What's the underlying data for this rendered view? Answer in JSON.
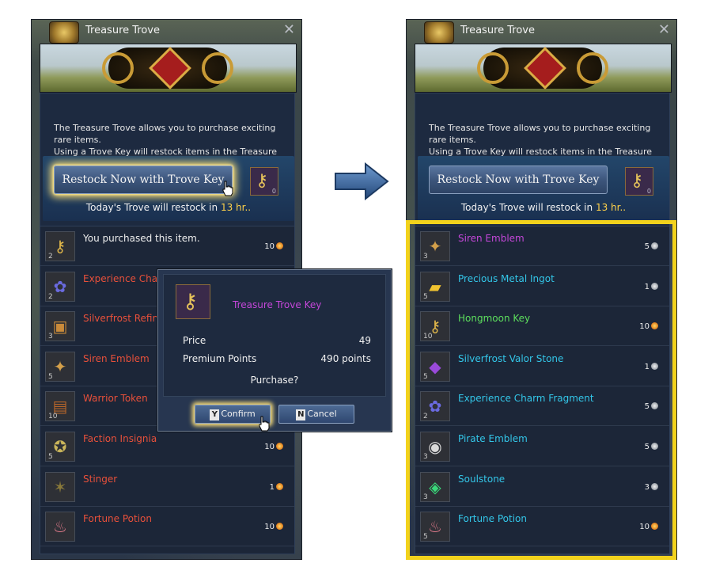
{
  "window_title": "Treasure Trove",
  "close_glyph": "✕",
  "description": {
    "line1": "The Treasure Trove allows you to purchase exciting rare items.",
    "line2": "Using a Trove Key will restock items in the Treasure Trove."
  },
  "restock": {
    "button_label": "Restock Now with Trove Key",
    "key_count": "0",
    "prefix": "Today's Trove will restock in",
    "hours": "13 hr..",
    "left_button_highlighted": true
  },
  "left_items": [
    {
      "name": "You purchased this item.",
      "qty": "2",
      "cost": "10",
      "coin": "gold",
      "color": "white",
      "icon": "key-icon"
    },
    {
      "name": "Experience Charm",
      "qty": "2",
      "cost": "",
      "coin": "",
      "color": "red",
      "icon": "charm-icon"
    },
    {
      "name": "Silverfrost Refinin",
      "qty": "3",
      "cost": "",
      "coin": "",
      "color": "red",
      "icon": "chest-icon"
    },
    {
      "name": "Siren Emblem",
      "qty": "5",
      "cost": "",
      "coin": "",
      "color": "red",
      "icon": "emblem-icon"
    },
    {
      "name": "Warrior Token",
      "qty": "10",
      "cost": "",
      "coin": "",
      "color": "red",
      "icon": "token-icon"
    },
    {
      "name": "Faction Insignia",
      "qty": "5",
      "cost": "10",
      "coin": "gold",
      "color": "red",
      "icon": "insignia-icon"
    },
    {
      "name": "Stinger",
      "qty": "",
      "cost": "1",
      "coin": "gold",
      "color": "red",
      "icon": "stinger-icon"
    },
    {
      "name": "Fortune Potion",
      "qty": "",
      "cost": "10",
      "coin": "gold",
      "color": "red",
      "icon": "potion-icon"
    }
  ],
  "right_items": [
    {
      "name": "Siren Emblem",
      "qty": "3",
      "cost": "5",
      "coin": "silver",
      "color": "purple",
      "icon": "emblem-icon"
    },
    {
      "name": "Precious Metal Ingot",
      "qty": "5",
      "cost": "1",
      "coin": "silver",
      "color": "cyan",
      "icon": "ingot-icon"
    },
    {
      "name": "Hongmoon Key",
      "qty": "10",
      "cost": "10",
      "coin": "gold",
      "color": "green",
      "icon": "key-icon"
    },
    {
      "name": "Silverfrost Valor Stone",
      "qty": "5",
      "cost": "1",
      "coin": "silver",
      "color": "cyan",
      "icon": "stone-icon"
    },
    {
      "name": "Experience Charm Fragment",
      "qty": "2",
      "cost": "5",
      "coin": "silver",
      "color": "cyan",
      "icon": "charm-icon"
    },
    {
      "name": "Pirate Emblem",
      "qty": "3",
      "cost": "5",
      "coin": "silver",
      "color": "cyan",
      "icon": "pirate-emblem-icon"
    },
    {
      "name": "Soulstone",
      "qty": "3",
      "cost": "3",
      "coin": "silver",
      "color": "cyan",
      "icon": "soulstone-icon"
    },
    {
      "name": "Fortune Potion",
      "qty": "5",
      "cost": "10",
      "coin": "gold",
      "color": "cyan",
      "icon": "potion-icon"
    }
  ],
  "dialog": {
    "item_name": "Treasure Trove Key",
    "price_label": "Price",
    "price_value": "49",
    "points_label": "Premium Points",
    "points_value": "490 points",
    "question": "Purchase?",
    "confirm_hotkey": "Y",
    "confirm_label": "Confirm",
    "cancel_hotkey": "N",
    "cancel_label": "Cancel"
  },
  "colors": {
    "highlight_frame": "#f2d21c",
    "hours_text": "#ffd24a",
    "arrow": "#3f6fa8"
  }
}
